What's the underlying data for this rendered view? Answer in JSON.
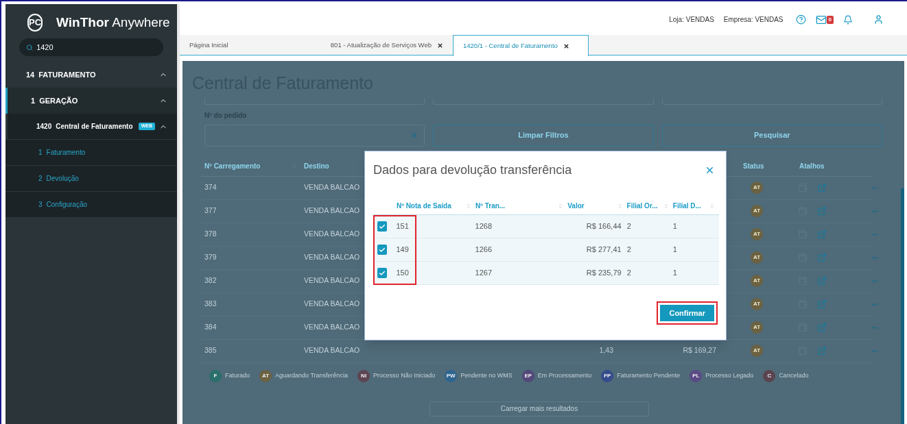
{
  "sidebar": {
    "logo": {
      "mark": "PC",
      "brand": "WinThor",
      "suffix": "Anywhere"
    },
    "search": {
      "value": "1420"
    },
    "tree": [
      {
        "code": "14",
        "label": "FATURAMENTO",
        "expanded": true,
        "children": [
          {
            "code": "1",
            "label": "GERAÇÃO",
            "expanded": true,
            "children": [
              {
                "code": "1420",
                "label": "Central de Faturamento",
                "badge": "WEB",
                "expanded": true,
                "children": [
                  {
                    "code": "1",
                    "label": "Faturamento"
                  },
                  {
                    "code": "2",
                    "label": "Devolução"
                  },
                  {
                    "code": "3",
                    "label": "Configuração"
                  }
                ]
              }
            ]
          }
        ]
      }
    ]
  },
  "topbar": {
    "store": "Loja: VENDAS",
    "company": "Empresa: VENDAS",
    "mail_count": "0"
  },
  "tabs": [
    {
      "label": "Página Inicial",
      "selected": false,
      "closable": false
    },
    {
      "label": "801 - Atualização de Serviços Web",
      "selected": false,
      "closable": true
    },
    {
      "label": "1420/1 - Central de Faturamento",
      "selected": true,
      "closable": true
    }
  ],
  "page": {
    "title": "Central de Faturamento",
    "order_label": "Nº do pedido",
    "clear_button": "Limpar Filtros",
    "search_button": "Pesquisar",
    "load_more": "Carregar mais resultados",
    "columns": [
      "Nº Carregamento",
      "Destino",
      "Status",
      "Atalhos"
    ],
    "rows": [
      {
        "load": "374",
        "destination": "VENDA BALCAO",
        "status": "AT"
      },
      {
        "load": "377",
        "destination": "VENDA BALCAO",
        "status": "AT"
      },
      {
        "load": "378",
        "destination": "VENDA BALCAO",
        "status": "AT"
      },
      {
        "load": "379",
        "destination": "VENDA BALCAO",
        "status": "AT"
      },
      {
        "load": "382",
        "destination": "VENDA BALCAO",
        "status": "AT"
      },
      {
        "load": "383",
        "destination": "VENDA BALCAO",
        "status": "AT"
      },
      {
        "load": "384",
        "destination": "VENDA BALCAO",
        "status": "AT"
      },
      {
        "load": "385",
        "destination": "VENDA BALCAO",
        "column_3": "1,43",
        "column_4": "R$ 169,27",
        "status": "AT"
      }
    ],
    "legend": [
      {
        "code": "F",
        "label": "Faturado",
        "color": "#2a6f6c"
      },
      {
        "code": "AT",
        "label": "Aguardando Transferência",
        "color": "#6b6242"
      },
      {
        "code": "NI",
        "label": "Processo Não Iniciado",
        "color": "#5e4453"
      },
      {
        "code": "PW",
        "label": "Pendente no WMS",
        "color": "#2d6590"
      },
      {
        "code": "EP",
        "label": "Em Processamento",
        "color": "#54477a"
      },
      {
        "code": "FP",
        "label": "Faturamento Pendente",
        "color": "#354c8c"
      },
      {
        "code": "PL",
        "label": "Processo Legado",
        "color": "#5a4a86"
      },
      {
        "code": "C",
        "label": "Cancelado",
        "color": "#5a4450"
      }
    ]
  },
  "modal": {
    "title": "Dados para devolução transferência",
    "highlight_first_column": true,
    "columns": [
      "Nº Nota de Saída",
      "Nº Tran...",
      "Valor",
      "Filial Or...",
      "Filial D..."
    ],
    "rows": [
      {
        "checked": true,
        "cells": [
          "151",
          "1268",
          "R$ 166,44",
          "2",
          "1"
        ]
      },
      {
        "checked": true,
        "cells": [
          "149",
          "1266",
          "R$ 277,41",
          "2",
          "1"
        ]
      },
      {
        "checked": true,
        "cells": [
          "150",
          "1267",
          "R$ 235,79",
          "2",
          "1"
        ]
      }
    ],
    "confirm": {
      "label": "Confirmar",
      "highlighted": true
    }
  }
}
